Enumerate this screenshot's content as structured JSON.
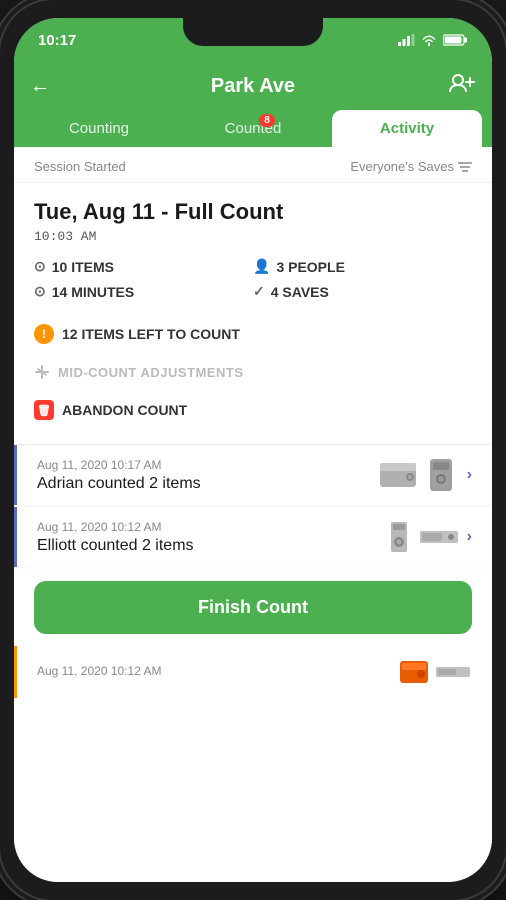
{
  "phone": {
    "status_bar": {
      "time": "10:17",
      "battery_icon": "battery-icon",
      "wifi_icon": "wifi-icon",
      "signal_icon": "signal-icon"
    }
  },
  "header": {
    "back_label": "←",
    "title": "Park Ave",
    "action_icon": "add-people-icon"
  },
  "tabs": [
    {
      "id": "counting",
      "label": "Counting",
      "active": false,
      "badge": null
    },
    {
      "id": "counted",
      "label": "Counted",
      "active": false,
      "badge": "8"
    },
    {
      "id": "activity",
      "label": "Activity",
      "active": true,
      "badge": null
    }
  ],
  "session": {
    "started_label": "Session Started",
    "filter_label": "Everyone's Saves",
    "filter_icon": "filter-icon"
  },
  "count_info": {
    "date_title": "Tue, Aug 11 - Full Count",
    "time": "10:03 AM",
    "stats": [
      {
        "icon": "items-icon",
        "value": "10 ITEMS"
      },
      {
        "icon": "people-icon",
        "value": "3 PEOPLE"
      },
      {
        "icon": "time-icon",
        "value": "14 MINUTES"
      },
      {
        "icon": "check-icon",
        "value": "4 SAVES"
      }
    ],
    "items_left": "12 ITEMS LEFT TO COUNT",
    "mid_count_label": "MID-COUNT ADJUSTMENTS",
    "abandon_label": "ABANDON COUNT"
  },
  "activity_items": [
    {
      "date": "Aug 11, 2020 10:17 AM",
      "description": "Adrian counted 2 items",
      "border_color": "#5c6bc0",
      "has_chevron": true,
      "thumbs": [
        "hd-flat",
        "tower"
      ]
    },
    {
      "date": "Aug 11, 2020 10:12 AM",
      "description": "Elliott counted 2 items",
      "border_color": "#5c6bc0",
      "has_chevron": true,
      "thumbs": [
        "tall-drive",
        "flat-drive2"
      ]
    },
    {
      "date": "Aug 11, 2020 10:12 AM",
      "description": "",
      "border_color": "#ff9500",
      "has_chevron": false,
      "thumbs": [
        "orange-drive",
        "flat-small"
      ]
    }
  ],
  "finish_button": {
    "label": "Finish Count"
  }
}
